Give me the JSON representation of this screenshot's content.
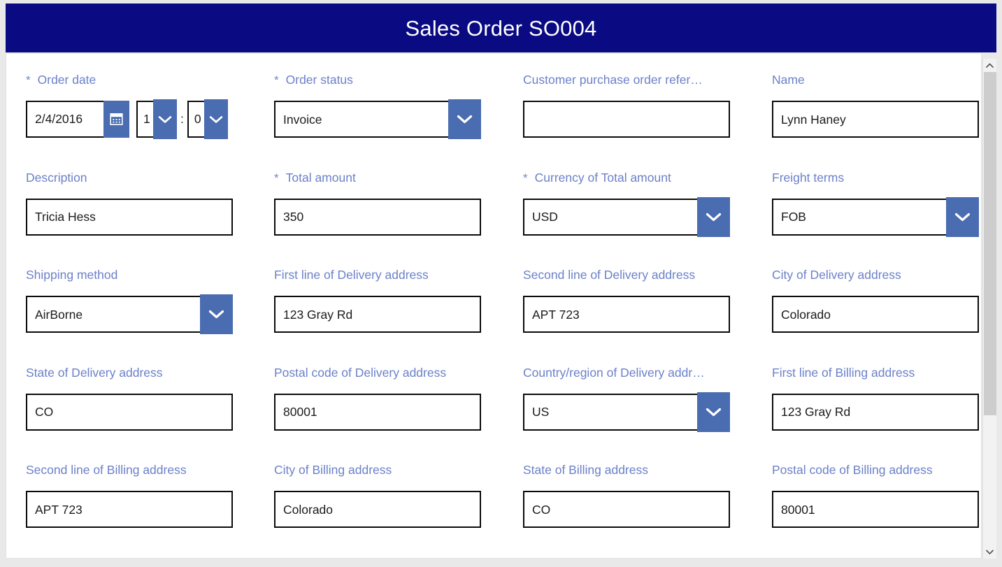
{
  "header": {
    "title": "Sales Order SO004",
    "bg_color": "#0a0a82",
    "text_color": "#ffffff"
  },
  "theme": {
    "label_color": "#6c81c9",
    "accent_button_color": "#4a6cb0",
    "input_border_color": "#0b0b0b",
    "page_background": "#e9e9e9",
    "card_background": "#ffffff"
  },
  "form": {
    "rows": [
      {
        "fields": [
          {
            "id": "order-date",
            "label": "Order date",
            "required": true,
            "type": "datetime",
            "date_value": "2/4/2016",
            "hour_value": "1",
            "minute_value": "0",
            "time_separator": ":",
            "calendar_icon": "calendar-icon"
          },
          {
            "id": "order-status",
            "label": "Order status",
            "required": true,
            "type": "select",
            "value": "Invoice"
          },
          {
            "id": "customer-purchase-order-reference",
            "label": "Customer purchase order refer…",
            "required": false,
            "type": "text",
            "value": ""
          },
          {
            "id": "name",
            "label": "Name",
            "required": false,
            "type": "text",
            "value": "Lynn Haney"
          }
        ]
      },
      {
        "fields": [
          {
            "id": "description",
            "label": "Description",
            "required": false,
            "type": "text",
            "value": "Tricia Hess"
          },
          {
            "id": "total-amount",
            "label": "Total amount",
            "required": true,
            "type": "text",
            "value": "350"
          },
          {
            "id": "currency-of-total-amount",
            "label": "Currency of Total amount",
            "required": true,
            "type": "select",
            "value": "USD"
          },
          {
            "id": "freight-terms",
            "label": "Freight terms",
            "required": false,
            "type": "select",
            "value": "FOB"
          }
        ]
      },
      {
        "fields": [
          {
            "id": "shipping-method",
            "label": "Shipping method",
            "required": false,
            "type": "select",
            "value": "AirBorne"
          },
          {
            "id": "first-line-of-delivery-address",
            "label": "First line of Delivery address",
            "required": false,
            "type": "text",
            "value": "123 Gray Rd"
          },
          {
            "id": "second-line-of-delivery-address",
            "label": "Second line of Delivery address",
            "required": false,
            "type": "text",
            "value": "APT 723"
          },
          {
            "id": "city-of-delivery-address",
            "label": "City of Delivery address",
            "required": false,
            "type": "text",
            "value": "Colorado"
          }
        ]
      },
      {
        "fields": [
          {
            "id": "state-of-delivery-address",
            "label": "State of Delivery address",
            "required": false,
            "type": "text",
            "value": "CO"
          },
          {
            "id": "postal-code-of-delivery-address",
            "label": "Postal code of Delivery address",
            "required": false,
            "type": "text",
            "value": "80001"
          },
          {
            "id": "country-region-of-delivery-address",
            "label": "Country/region of Delivery addr…",
            "required": false,
            "type": "select",
            "value": "US"
          },
          {
            "id": "first-line-of-billing-address",
            "label": "First line of Billing address",
            "required": false,
            "type": "text",
            "value": "123 Gray Rd"
          }
        ]
      },
      {
        "fields": [
          {
            "id": "second-line-of-billing-address",
            "label": "Second line of Billing address",
            "required": false,
            "type": "text",
            "value": "APT 723"
          },
          {
            "id": "city-of-billing-address",
            "label": "City of Billing address",
            "required": false,
            "type": "text",
            "value": "Colorado"
          },
          {
            "id": "state-of-billing-address",
            "label": "State of Billing address",
            "required": false,
            "type": "text",
            "value": "CO"
          },
          {
            "id": "postal-code-of-billing-address",
            "label": "Postal code of Billing address",
            "required": false,
            "type": "text",
            "value": "80001"
          }
        ]
      }
    ],
    "required_marker": "*"
  },
  "scrollbar": {
    "up_arrow_icon": "chevron-up-icon",
    "down_arrow_icon": "chevron-down-icon",
    "thumb_position_percent": 0,
    "thumb_size_percent": 70
  }
}
